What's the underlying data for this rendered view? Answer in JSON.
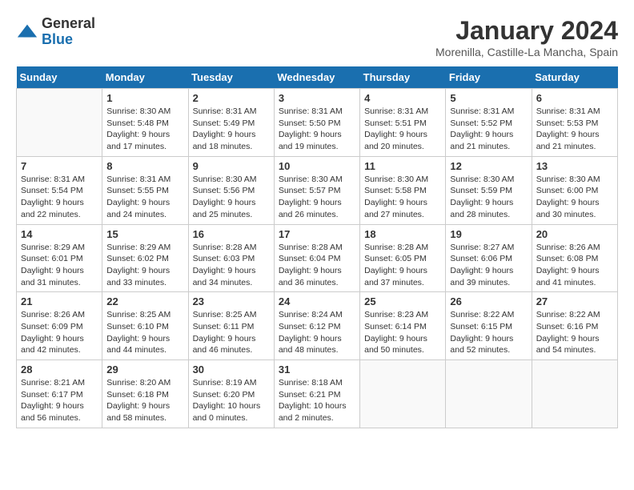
{
  "logo": {
    "general": "General",
    "blue": "Blue"
  },
  "title": "January 2024",
  "subtitle": "Morenilla, Castille-La Mancha, Spain",
  "days_of_week": [
    "Sunday",
    "Monday",
    "Tuesday",
    "Wednesday",
    "Thursday",
    "Friday",
    "Saturday"
  ],
  "weeks": [
    [
      {
        "day": "",
        "sunrise": "",
        "sunset": "",
        "daylight": ""
      },
      {
        "day": "1",
        "sunrise": "Sunrise: 8:30 AM",
        "sunset": "Sunset: 5:48 PM",
        "daylight": "Daylight: 9 hours and 17 minutes."
      },
      {
        "day": "2",
        "sunrise": "Sunrise: 8:31 AM",
        "sunset": "Sunset: 5:49 PM",
        "daylight": "Daylight: 9 hours and 18 minutes."
      },
      {
        "day": "3",
        "sunrise": "Sunrise: 8:31 AM",
        "sunset": "Sunset: 5:50 PM",
        "daylight": "Daylight: 9 hours and 19 minutes."
      },
      {
        "day": "4",
        "sunrise": "Sunrise: 8:31 AM",
        "sunset": "Sunset: 5:51 PM",
        "daylight": "Daylight: 9 hours and 20 minutes."
      },
      {
        "day": "5",
        "sunrise": "Sunrise: 8:31 AM",
        "sunset": "Sunset: 5:52 PM",
        "daylight": "Daylight: 9 hours and 21 minutes."
      },
      {
        "day": "6",
        "sunrise": "Sunrise: 8:31 AM",
        "sunset": "Sunset: 5:53 PM",
        "daylight": "Daylight: 9 hours and 21 minutes."
      }
    ],
    [
      {
        "day": "7",
        "sunrise": "Sunrise: 8:31 AM",
        "sunset": "Sunset: 5:54 PM",
        "daylight": "Daylight: 9 hours and 22 minutes."
      },
      {
        "day": "8",
        "sunrise": "Sunrise: 8:31 AM",
        "sunset": "Sunset: 5:55 PM",
        "daylight": "Daylight: 9 hours and 24 minutes."
      },
      {
        "day": "9",
        "sunrise": "Sunrise: 8:30 AM",
        "sunset": "Sunset: 5:56 PM",
        "daylight": "Daylight: 9 hours and 25 minutes."
      },
      {
        "day": "10",
        "sunrise": "Sunrise: 8:30 AM",
        "sunset": "Sunset: 5:57 PM",
        "daylight": "Daylight: 9 hours and 26 minutes."
      },
      {
        "day": "11",
        "sunrise": "Sunrise: 8:30 AM",
        "sunset": "Sunset: 5:58 PM",
        "daylight": "Daylight: 9 hours and 27 minutes."
      },
      {
        "day": "12",
        "sunrise": "Sunrise: 8:30 AM",
        "sunset": "Sunset: 5:59 PM",
        "daylight": "Daylight: 9 hours and 28 minutes."
      },
      {
        "day": "13",
        "sunrise": "Sunrise: 8:30 AM",
        "sunset": "Sunset: 6:00 PM",
        "daylight": "Daylight: 9 hours and 30 minutes."
      }
    ],
    [
      {
        "day": "14",
        "sunrise": "Sunrise: 8:29 AM",
        "sunset": "Sunset: 6:01 PM",
        "daylight": "Daylight: 9 hours and 31 minutes."
      },
      {
        "day": "15",
        "sunrise": "Sunrise: 8:29 AM",
        "sunset": "Sunset: 6:02 PM",
        "daylight": "Daylight: 9 hours and 33 minutes."
      },
      {
        "day": "16",
        "sunrise": "Sunrise: 8:28 AM",
        "sunset": "Sunset: 6:03 PM",
        "daylight": "Daylight: 9 hours and 34 minutes."
      },
      {
        "day": "17",
        "sunrise": "Sunrise: 8:28 AM",
        "sunset": "Sunset: 6:04 PM",
        "daylight": "Daylight: 9 hours and 36 minutes."
      },
      {
        "day": "18",
        "sunrise": "Sunrise: 8:28 AM",
        "sunset": "Sunset: 6:05 PM",
        "daylight": "Daylight: 9 hours and 37 minutes."
      },
      {
        "day": "19",
        "sunrise": "Sunrise: 8:27 AM",
        "sunset": "Sunset: 6:06 PM",
        "daylight": "Daylight: 9 hours and 39 minutes."
      },
      {
        "day": "20",
        "sunrise": "Sunrise: 8:26 AM",
        "sunset": "Sunset: 6:08 PM",
        "daylight": "Daylight: 9 hours and 41 minutes."
      }
    ],
    [
      {
        "day": "21",
        "sunrise": "Sunrise: 8:26 AM",
        "sunset": "Sunset: 6:09 PM",
        "daylight": "Daylight: 9 hours and 42 minutes."
      },
      {
        "day": "22",
        "sunrise": "Sunrise: 8:25 AM",
        "sunset": "Sunset: 6:10 PM",
        "daylight": "Daylight: 9 hours and 44 minutes."
      },
      {
        "day": "23",
        "sunrise": "Sunrise: 8:25 AM",
        "sunset": "Sunset: 6:11 PM",
        "daylight": "Daylight: 9 hours and 46 minutes."
      },
      {
        "day": "24",
        "sunrise": "Sunrise: 8:24 AM",
        "sunset": "Sunset: 6:12 PM",
        "daylight": "Daylight: 9 hours and 48 minutes."
      },
      {
        "day": "25",
        "sunrise": "Sunrise: 8:23 AM",
        "sunset": "Sunset: 6:14 PM",
        "daylight": "Daylight: 9 hours and 50 minutes."
      },
      {
        "day": "26",
        "sunrise": "Sunrise: 8:22 AM",
        "sunset": "Sunset: 6:15 PM",
        "daylight": "Daylight: 9 hours and 52 minutes."
      },
      {
        "day": "27",
        "sunrise": "Sunrise: 8:22 AM",
        "sunset": "Sunset: 6:16 PM",
        "daylight": "Daylight: 9 hours and 54 minutes."
      }
    ],
    [
      {
        "day": "28",
        "sunrise": "Sunrise: 8:21 AM",
        "sunset": "Sunset: 6:17 PM",
        "daylight": "Daylight: 9 hours and 56 minutes."
      },
      {
        "day": "29",
        "sunrise": "Sunrise: 8:20 AM",
        "sunset": "Sunset: 6:18 PM",
        "daylight": "Daylight: 9 hours and 58 minutes."
      },
      {
        "day": "30",
        "sunrise": "Sunrise: 8:19 AM",
        "sunset": "Sunset: 6:20 PM",
        "daylight": "Daylight: 10 hours and 0 minutes."
      },
      {
        "day": "31",
        "sunrise": "Sunrise: 8:18 AM",
        "sunset": "Sunset: 6:21 PM",
        "daylight": "Daylight: 10 hours and 2 minutes."
      },
      {
        "day": "",
        "sunrise": "",
        "sunset": "",
        "daylight": ""
      },
      {
        "day": "",
        "sunrise": "",
        "sunset": "",
        "daylight": ""
      },
      {
        "day": "",
        "sunrise": "",
        "sunset": "",
        "daylight": ""
      }
    ]
  ]
}
